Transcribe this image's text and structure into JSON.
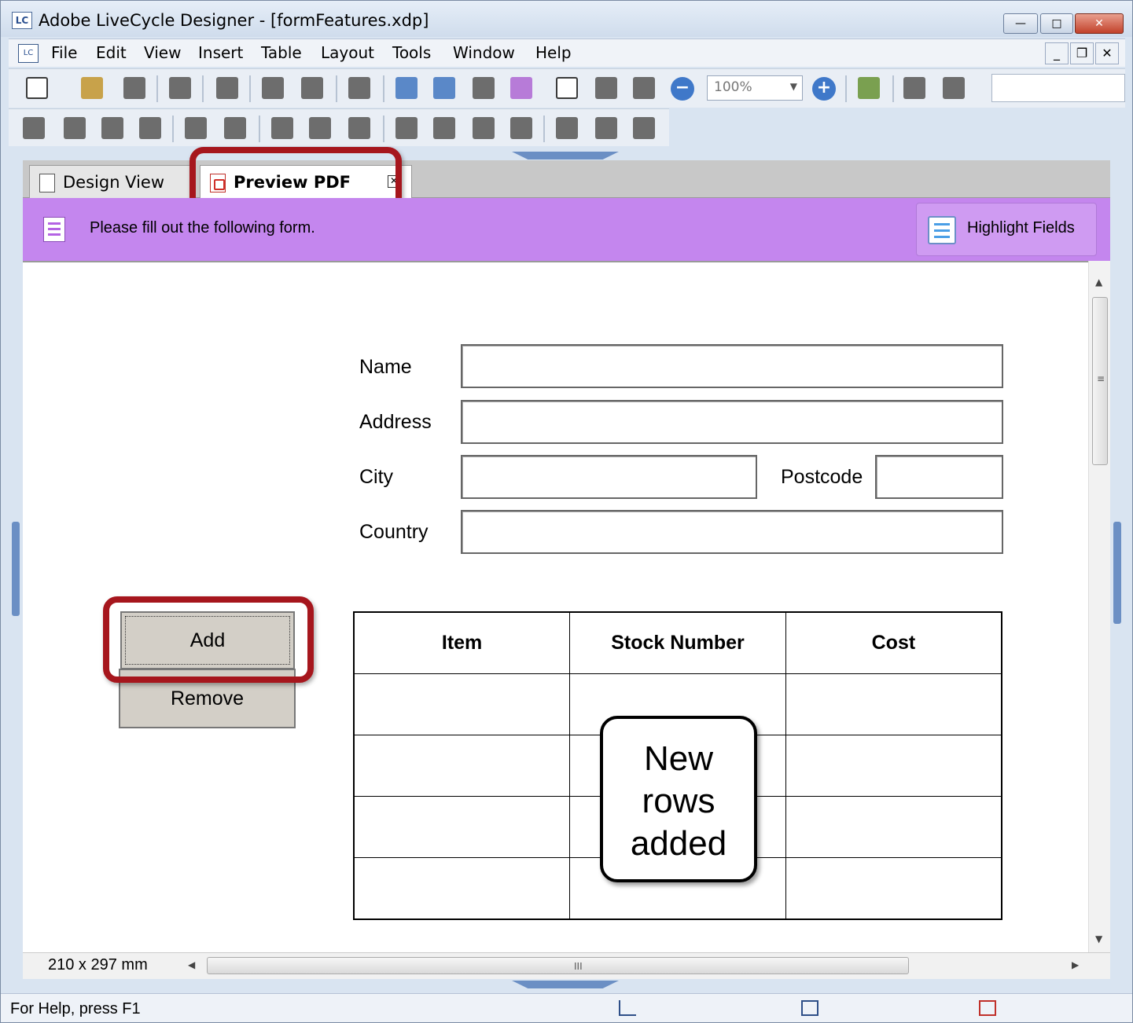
{
  "window": {
    "title": "Adobe LiveCycle Designer - [formFeatures.xdp]",
    "app_icon_text": "LC",
    "controls": [
      "minimize",
      "maximize",
      "close"
    ]
  },
  "menu": {
    "items": [
      "File",
      "Edit",
      "View",
      "Insert",
      "Table",
      "Layout",
      "Tools",
      "Window",
      "Help"
    ]
  },
  "toolbar": {
    "zoom_value": "100%"
  },
  "tabs": [
    {
      "label": "Design View",
      "active": false
    },
    {
      "label": "Preview PDF",
      "active": true,
      "highlighted": true
    }
  ],
  "banner": {
    "message": "Please fill out the following form.",
    "highlight_button": "Highlight Fields",
    "color": "#c486ee"
  },
  "form": {
    "labels": {
      "name": "Name",
      "address": "Address",
      "city": "City",
      "postcode": "Postcode",
      "country": "Country"
    },
    "values": {
      "name": "",
      "address": "",
      "city": "",
      "postcode": "",
      "country": ""
    },
    "add_button": "Add",
    "remove_button": "Remove",
    "table": {
      "headers": [
        "Item",
        "Stock Number",
        "Cost"
      ],
      "rows": [
        [
          "",
          "",
          ""
        ],
        [
          "",
          "",
          ""
        ],
        [
          "",
          "",
          ""
        ],
        [
          "",
          "",
          ""
        ]
      ]
    }
  },
  "annotation": {
    "callout_lines": [
      "New",
      "rows",
      "added"
    ],
    "highlight_color": "#a6161d"
  },
  "bottom": {
    "page_size": "210 x 297 mm",
    "scroll_grip": "III"
  },
  "status": {
    "help_text": "For Help, press F1"
  }
}
